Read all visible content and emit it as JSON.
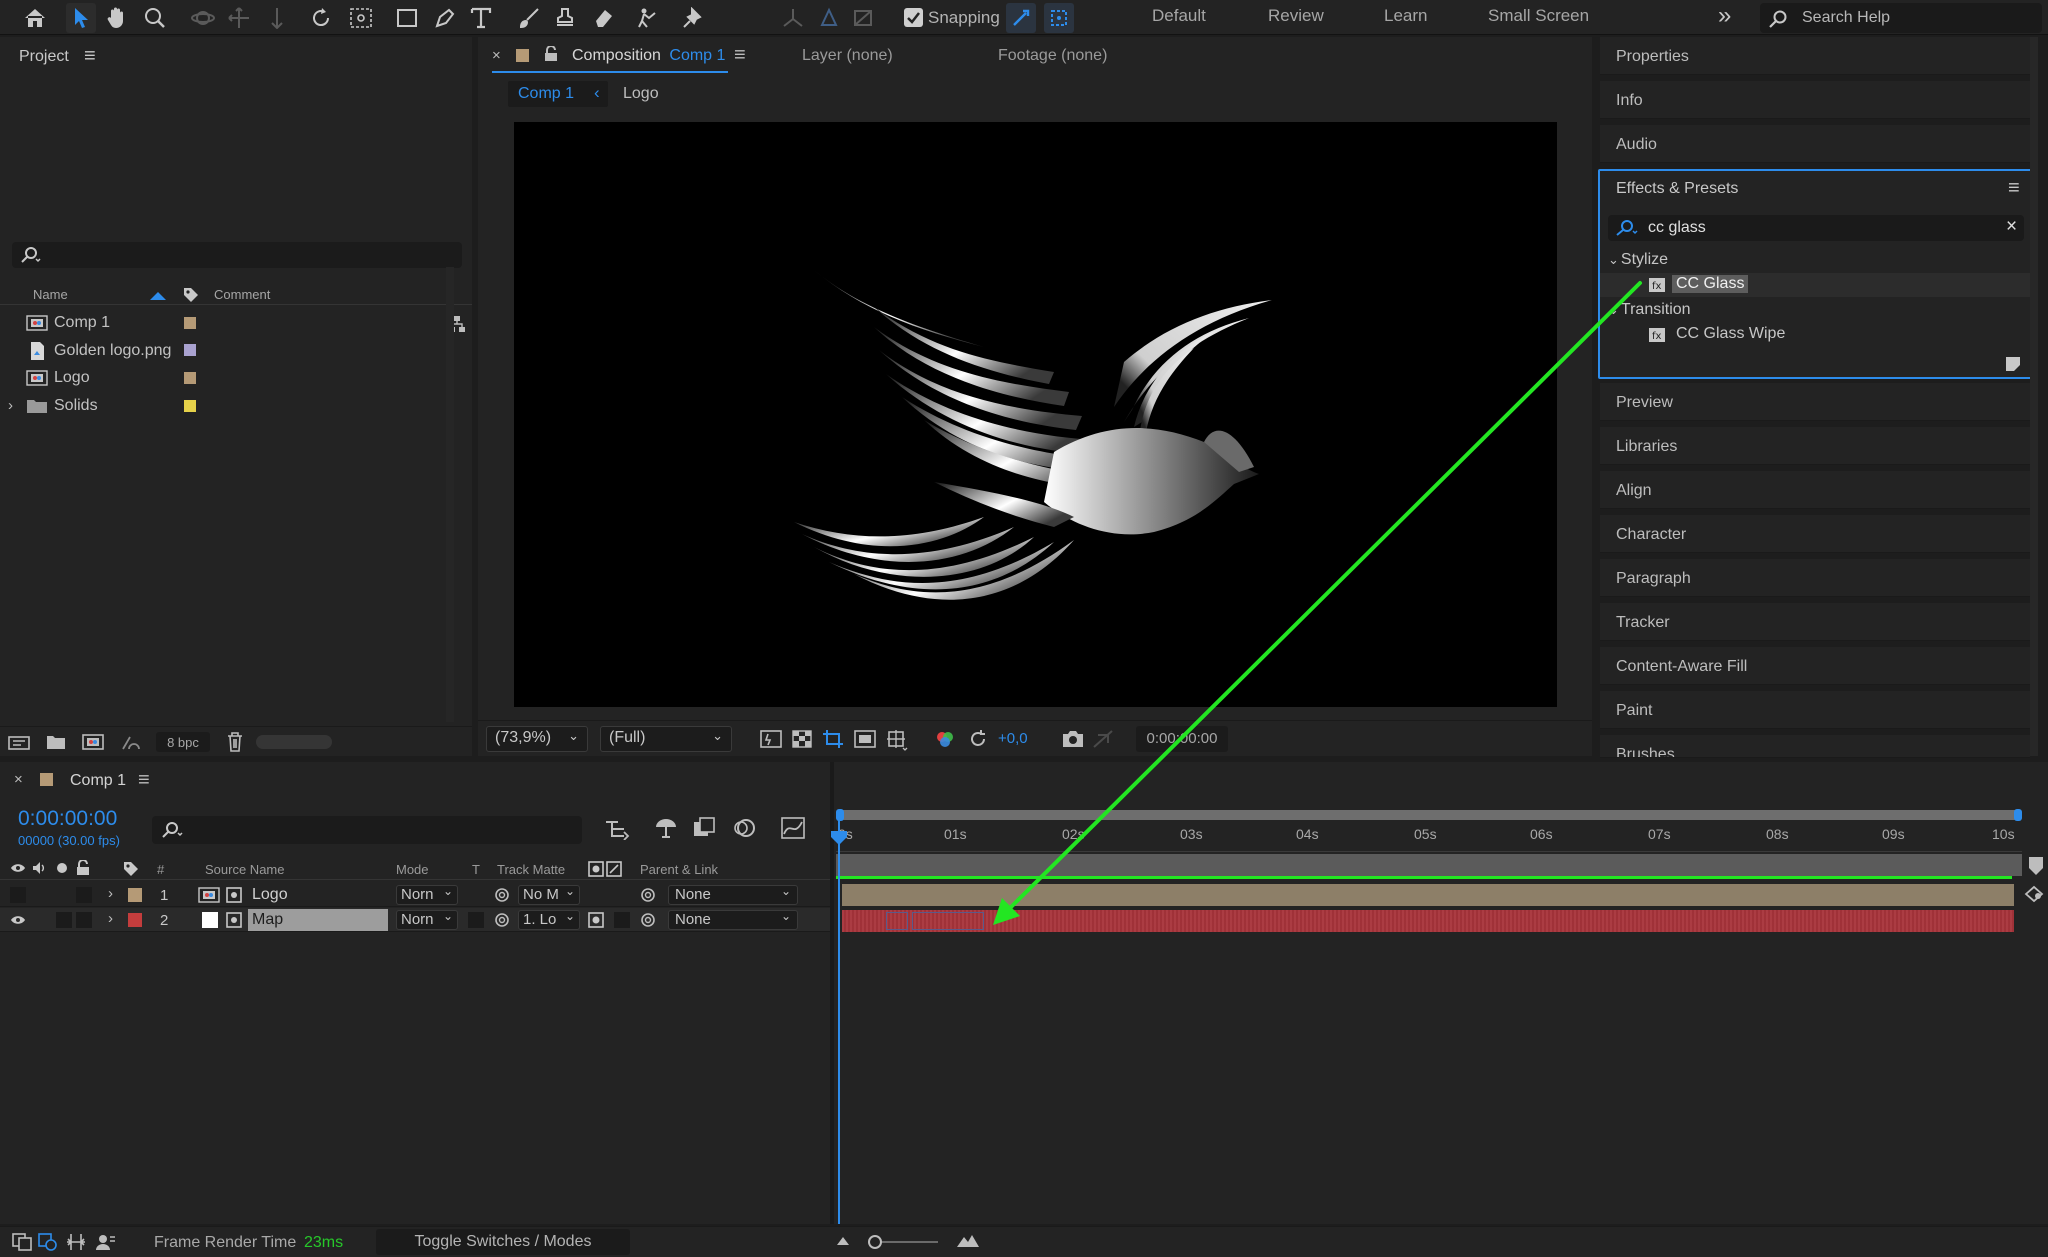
{
  "toolbar": {
    "snapping_label": "Snapping",
    "workspaces": [
      "Default",
      "Review",
      "Learn",
      "Small Screen"
    ],
    "search_help": "Search Help",
    "more_glyph": "»",
    "accent": "#2d8ceb"
  },
  "project": {
    "title": "Project",
    "menu_glyph": "≡",
    "columns": {
      "name": "Name",
      "comment": "Comment"
    },
    "items": [
      {
        "name": "Comp 1",
        "icon": "composition-icon",
        "swatch": "#b59a76"
      },
      {
        "name": "Golden logo.png",
        "icon": "image-file-icon",
        "swatch": "#a9a2cf"
      },
      {
        "name": "Logo",
        "icon": "composition-icon",
        "swatch": "#b59a76"
      },
      {
        "name": "Solids",
        "icon": "folder-icon",
        "swatch": "#e6d24a"
      }
    ],
    "bpc": "8 bpc"
  },
  "comp_viewer": {
    "tab_prefix": "Composition",
    "tab_comp": "Comp 1",
    "layer_tab": "Layer (none)",
    "footage_tab": "Footage (none)",
    "breadcrumb": [
      "Comp 1",
      "Logo"
    ],
    "zoom": "(73,9%)",
    "resolution": "(Full)",
    "exposure": "+0,0",
    "timecode": "0:00:00:00"
  },
  "right_panel": {
    "top_items": [
      "Properties",
      "Info",
      "Audio"
    ],
    "effects": {
      "title": "Effects & Presets",
      "search_value": "cc glass",
      "groups": [
        {
          "name": "Stylize",
          "items": [
            "CC Glass"
          ]
        },
        {
          "name": "Transition",
          "items": [
            "CC Glass Wipe"
          ]
        }
      ]
    },
    "bottom_items": [
      "Preview",
      "Libraries",
      "Align",
      "Character",
      "Paragraph",
      "Tracker",
      "Content-Aware Fill",
      "Paint",
      "Brushes"
    ]
  },
  "timeline": {
    "comp_name": "Comp 1",
    "timecode": "0:00:00:00",
    "frame_info": "00000 (30.00 fps)",
    "columns": {
      "num": "#",
      "source": "Source Name",
      "mode": "Mode",
      "t": "T",
      "matte": "Track Matte",
      "parent": "Parent & Link"
    },
    "layers": [
      {
        "num": "1",
        "name": "Logo",
        "mode": "Norn",
        "matte": "No M",
        "parent": "None",
        "swatch": "#b59a76",
        "bar_color": "#8d7f68"
      },
      {
        "num": "2",
        "name": "Map",
        "mode": "Norn",
        "matte": "1. Lo",
        "parent": "None",
        "swatch": "#c43d3d",
        "bar_color": "#a8343b"
      }
    ],
    "ruler": [
      "0s",
      "01s",
      "02s",
      "03s",
      "04s",
      "05s",
      "06s",
      "07s",
      "08s",
      "09s",
      "10s"
    ]
  },
  "status_bar": {
    "frame_render_label": "Frame Render Time",
    "frame_render_value": "23ms",
    "toggle_label": "Toggle Switches / Modes"
  },
  "annotation": {
    "arrow_color": "#23e622"
  }
}
